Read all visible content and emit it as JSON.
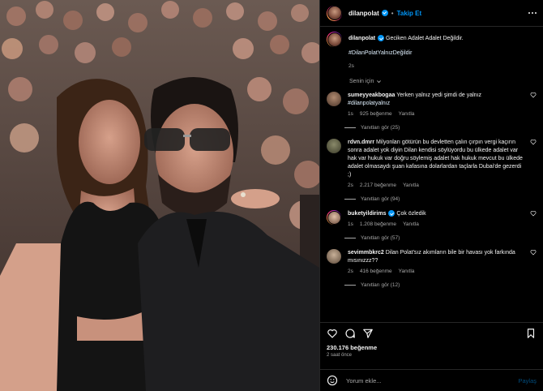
{
  "post": {
    "username": "dilanpolat",
    "follow_label": "Takip Et",
    "caption": "Geciken Adalet Adalet Değildir.",
    "hashtag": "#DilanPolatYalnızDeğildir",
    "caption_time": "2s",
    "sort_label": "Senin için",
    "likes": "230.176 beğenme",
    "posted_ago": "2 saat önce",
    "comment_placeholder": "Yorum ekle...",
    "post_button": "Paylaş"
  },
  "comments": [
    {
      "user": "sumeyyeakbogaa",
      "text": "Yerken yalnız yedi şimdi de yalnız",
      "tag": "#dilanpolatyalnız",
      "time": "1s",
      "likes": "925 beğenme",
      "reply": "Yanıtla",
      "view_replies": "Yanıtları gör (25)"
    },
    {
      "user": "rdvn.dmrr",
      "text": "Milyonları götürün bu devletten çalın çırpın vergi kaçırın sonra adalet yok diyin Dilan kendisi söylüyordu bu ülkede adalet var hak var hukuk var doğru söylemiş adalet hak hukuk mevcut bu ülkede adalet olmasaydı şuan kafasına dolarlardan taçlarla Dubai'de gezerdi ;)",
      "time": "2s",
      "likes": "2.217 beğenme",
      "reply": "Yanıtla",
      "view_replies": "Yanıtları gör (94)"
    },
    {
      "user": "buketyildirims",
      "text": "Çok özledik",
      "time": "1s",
      "likes": "1.208 beğenme",
      "reply": "Yanıtla",
      "view_replies": "Yanıtları gör (57)"
    },
    {
      "user": "sevimmbkrc2",
      "text": "Dilan Polat'sız akımların bile bir havası yok farkında mısınızzz??",
      "time": "2s",
      "likes": "416 beğenme",
      "reply": "Yanıtla",
      "view_replies": "Yanıtları gör (12)"
    }
  ],
  "colors": {
    "accent": "#0095f6",
    "background": "#000000",
    "muted": "#a8a8a8"
  }
}
